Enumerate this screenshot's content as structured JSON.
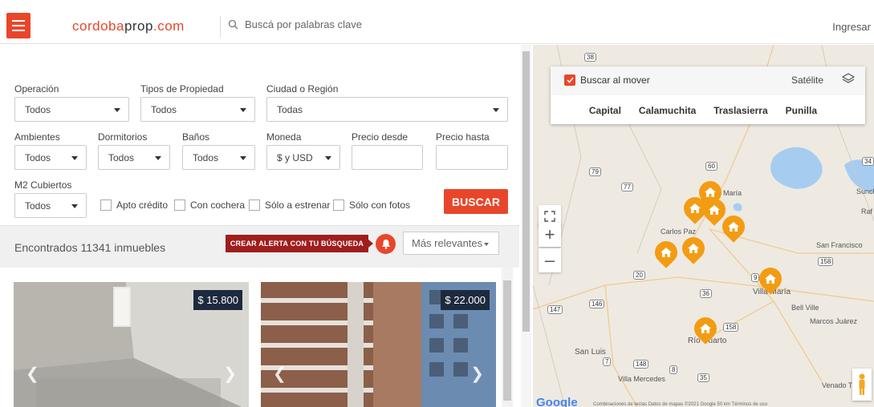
{
  "header": {
    "logo_part1": "cordoba",
    "logo_part2": "prop",
    "logo_part3": ".com",
    "search_placeholder": "Buscá por palabras clave",
    "login": "Ingresar"
  },
  "filters": {
    "operacion": {
      "label": "Operación",
      "value": "Todos"
    },
    "tipos": {
      "label": "Tipos de Propiedad",
      "value": "Todos"
    },
    "ciudad": {
      "label": "Ciudad o Región",
      "value": "Todas"
    },
    "ambientes": {
      "label": "Ambientes",
      "value": "Todos"
    },
    "dormitorios": {
      "label": "Dormitorios",
      "value": "Todos"
    },
    "banos": {
      "label": "Baños",
      "value": "Todos"
    },
    "moneda": {
      "label": "Moneda",
      "value": "$ y USD"
    },
    "precio_desde": {
      "label": "Precio desde"
    },
    "precio_hasta": {
      "label": "Precio hasta"
    },
    "m2": {
      "label": "M2 Cubiertos",
      "value": "Todos"
    },
    "checkboxes": [
      "Apto crédito",
      "Con cochera",
      "Sólo a estrenar",
      "Sólo con fotos"
    ],
    "search_button": "BUSCAR"
  },
  "results": {
    "found_text": "Encontrados 11341 inmuebles",
    "alert_button": "CREAR ALERTA CON TU BÚSQUEDA",
    "sort_value": "Más relevantes"
  },
  "cards": [
    {
      "price": "$ 15.800"
    },
    {
      "price": "$ 22.000"
    }
  ],
  "map": {
    "move_search": "Buscar al mover",
    "satellite": "Satélite",
    "regions": [
      "Capital",
      "Calamuchita",
      "Traslasierra",
      "Punilla"
    ],
    "labels": [
      "Carlos Paz",
      "Villa María",
      "Bell Ville",
      "Río Cuarto",
      "San Luis",
      "Villa Mercedes",
      "San Francisco",
      "Marcos Juárez",
      "Venado T",
      "María",
      "Sunch",
      "Raf"
    ],
    "route_numbers": [
      "38",
      "79",
      "60",
      "34",
      "77",
      "158",
      "20",
      "36",
      "146",
      "147",
      "148",
      "8",
      "35",
      "7",
      "9",
      "158"
    ],
    "footer": "Combinaciones de teclas   Datos de mapas ©2021 Google   50 km   Términos de uso",
    "brand": "Google"
  },
  "colors": {
    "brand": "#e8462b",
    "alert": "#a01d1d",
    "price_bg": "#1d2a3e",
    "pin": "#f39c12"
  }
}
